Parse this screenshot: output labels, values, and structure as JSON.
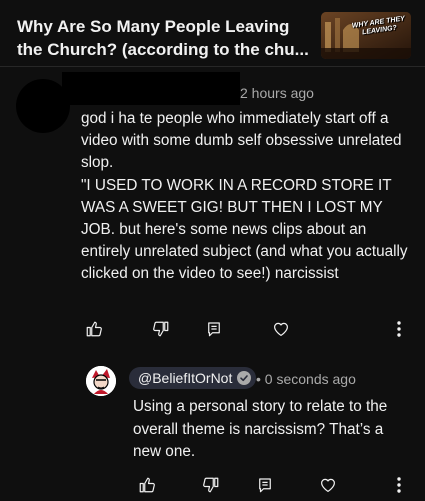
{
  "video": {
    "title": "Why Are So Many People Leaving the Church? (according to the chu...",
    "thumbnail_text": "WHY ARE THEY LEAVING?"
  },
  "comment": {
    "author_redacted": true,
    "timestamp": "2 hours ago",
    "text": "god i ha te people who immediately start off a video with some dumb self obsessive unrelated slop.\n\"I USED TO WORK IN A RECORD STORE IT WAS A SWEET GIG! BUT THEN I LOST MY JOB. but here's some news clips about an entirely unrelated subject (and what you actually clicked on the video to see!) narcissist",
    "actions": [
      "like-icon",
      "dislike-icon",
      "reply-icon",
      "heart-icon",
      "more-vert-icon"
    ]
  },
  "reply": {
    "handle": "@BeliefItOrNot",
    "separator": "•",
    "timestamp": "0 seconds ago",
    "text": "Using a personal story to relate to the overall theme is narcissism? That’s a new one.",
    "actions": [
      "like-icon",
      "dislike-icon",
      "reply-icon",
      "heart-icon",
      "more-vert-icon"
    ]
  },
  "colors": {
    "background": "#0f0f0f",
    "text_primary": "#f1f1f1",
    "text_secondary": "#aaaaaa",
    "handle_pill": "#2a2d3a"
  }
}
